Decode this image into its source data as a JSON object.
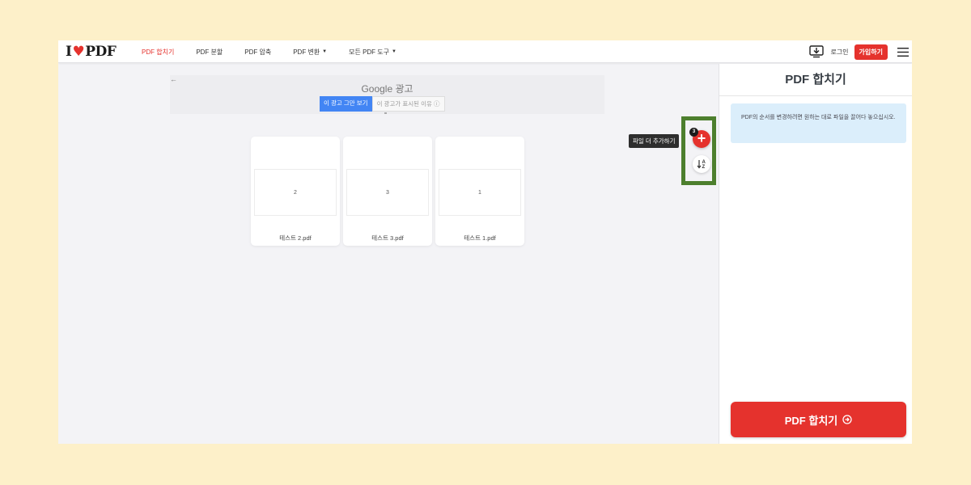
{
  "brand": {
    "logo_left": "I",
    "logo_heart": "♥",
    "logo_right": "PDF",
    "accent": "#e5322d"
  },
  "nav": {
    "items": [
      {
        "label": "PDF 합치기",
        "active": true
      },
      {
        "label": "PDF 분할",
        "active": false
      },
      {
        "label": "PDF 압축",
        "active": false
      },
      {
        "label": "PDF 변환",
        "active": false,
        "dropdown": true
      },
      {
        "label": "모든 PDF 도구",
        "active": false,
        "dropdown": true
      }
    ],
    "caret": "▼"
  },
  "header": {
    "download_icon": "desktop-download-icon",
    "login": "로그인",
    "signup": "가입하기",
    "menu_icon": "hamburger-menu-icon"
  },
  "ad": {
    "back": "←",
    "title": "Google 광고",
    "stop_button": "이 광고 그만 보기",
    "why_button": "이 광고가 표시된 이유 ⓘ"
  },
  "files": [
    {
      "page": "2",
      "name": "테스트 2.pdf"
    },
    {
      "page": "3",
      "name": "테스트 3.pdf"
    },
    {
      "page": "1",
      "name": "테스트 1.pdf"
    }
  ],
  "tools": {
    "tooltip": "파일 더 추가하기",
    "count": "3",
    "add": "+",
    "sort_icon": "sort-alpha-icon",
    "sort_glyph": "↓A Z"
  },
  "sidebar": {
    "title": "PDF 합치기",
    "info": "PDF의 순서를 변경하려면 원하는 대로 파일을 끌어다 놓으십시오.",
    "merge_button": "PDF 합치기"
  }
}
